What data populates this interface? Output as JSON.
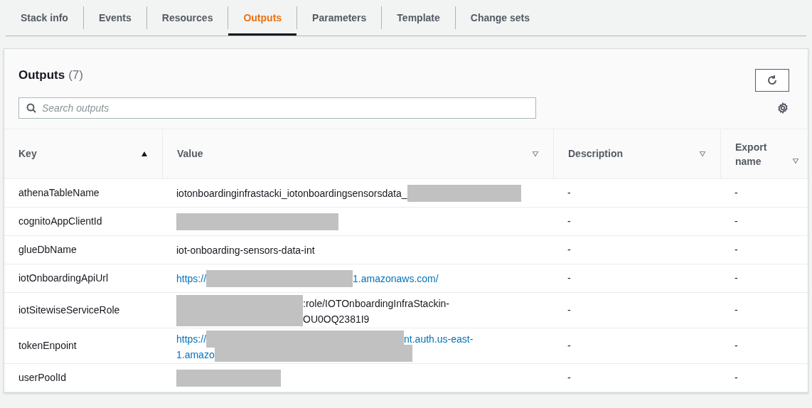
{
  "tabs": [
    {
      "label": "Stack info",
      "selected": false
    },
    {
      "label": "Events",
      "selected": false
    },
    {
      "label": "Resources",
      "selected": false
    },
    {
      "label": "Outputs",
      "selected": true
    },
    {
      "label": "Parameters",
      "selected": false
    },
    {
      "label": "Template",
      "selected": false
    },
    {
      "label": "Change sets",
      "selected": false
    }
  ],
  "panel": {
    "title": "Outputs",
    "count": "(7)",
    "search": {
      "placeholder": "Search outputs"
    }
  },
  "table": {
    "columns": [
      {
        "label": "Key",
        "sorted": true
      },
      {
        "label": "Value",
        "sorted": false
      },
      {
        "label": "Description",
        "sorted": false
      },
      {
        "label": "Export name",
        "sorted": false
      }
    ],
    "rows": [
      {
        "key": "athenaTableName",
        "link": false,
        "lines": [
          [
            {
              "kind": "text",
              "text": "iotonboardinginfrastacki_iotonboardingsensorsdata_"
            },
            {
              "kind": "redacted"
            }
          ]
        ],
        "description": "-",
        "export_name": "-"
      },
      {
        "key": "cognitoAppClientId",
        "lines": [
          [
            {
              "kind": "redacted"
            }
          ]
        ],
        "description": "-",
        "export_name": "-"
      },
      {
        "key": "glueDbName",
        "link": false,
        "lines": [
          [
            {
              "kind": "text",
              "text": "iot-onboarding-sensors-data-int"
            }
          ]
        ],
        "description": "-",
        "export_name": "-"
      },
      {
        "key": "iotOnboardingApiUrl",
        "link": true,
        "lines": [
          [
            {
              "kind": "text",
              "text": "https://"
            },
            {
              "kind": "redacted"
            },
            {
              "kind": "text",
              "text": "1.amazonaws.com/"
            }
          ]
        ],
        "description": "-",
        "export_name": "-"
      },
      {
        "key": "iotSitewiseServiceRole",
        "link": false,
        "lines": [
          [
            {
              "kind": "redacted"
            },
            {
              "kind": "text",
              "text": ":role/IOTOnboardingInfraStackin-"
            }
          ],
          [
            {
              "kind": "redacted"
            },
            {
              "kind": "text",
              "text": "OU0OQ2381I9"
            }
          ]
        ],
        "description": "-",
        "export_name": "-"
      },
      {
        "key": "tokenEnpoint",
        "link": true,
        "lines": [
          [
            {
              "kind": "text",
              "text": "https://"
            },
            {
              "kind": "redacted"
            },
            {
              "kind": "text",
              "text": "nt.auth.us-east-"
            }
          ],
          [
            {
              "kind": "text",
              "text": "1.amazo"
            },
            {
              "kind": "redacted"
            }
          ]
        ],
        "description": "-",
        "export_name": "-"
      },
      {
        "key": "userPoolId",
        "lines": [
          [
            {
              "kind": "redacted"
            }
          ]
        ],
        "description": "-",
        "export_name": "-"
      }
    ]
  }
}
